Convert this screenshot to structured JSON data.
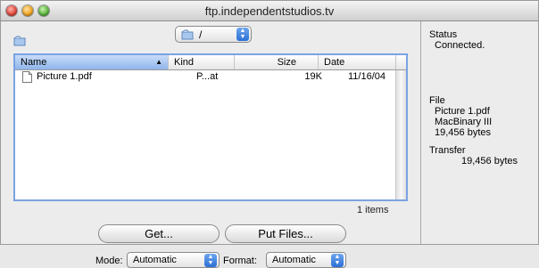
{
  "window": {
    "title": "ftp.independentstudios.tv"
  },
  "path_popup": {
    "label": "/"
  },
  "file_list": {
    "columns": [
      "Name",
      "Kind",
      "Size",
      "Date"
    ],
    "rows": [
      {
        "name": "Picture 1.pdf",
        "kind": "P...at",
        "size": "19K",
        "date": "11/16/04"
      }
    ],
    "count_label": "1 items"
  },
  "buttons": {
    "get": "Get...",
    "put": "Put Files..."
  },
  "mode": {
    "label": "Mode:",
    "value": "Automatic"
  },
  "format": {
    "label": "Format:",
    "value": "Automatic"
  },
  "status_panel": {
    "status_title": "Status",
    "status_value": "Connected.",
    "file_title": "File",
    "file_name": "Picture 1.pdf",
    "file_encoding": "MacBinary III",
    "file_bytes": "19,456 bytes",
    "transfer_title": "Transfer",
    "transfer_bytes": "19,456 bytes"
  },
  "icons": [
    "folder-icon",
    "pdf-file-icon",
    "stepper-icon",
    "sort-arrow-icon"
  ],
  "colors": {
    "accent": "#7aa3e3",
    "header_selected": "#8fb5ec"
  }
}
